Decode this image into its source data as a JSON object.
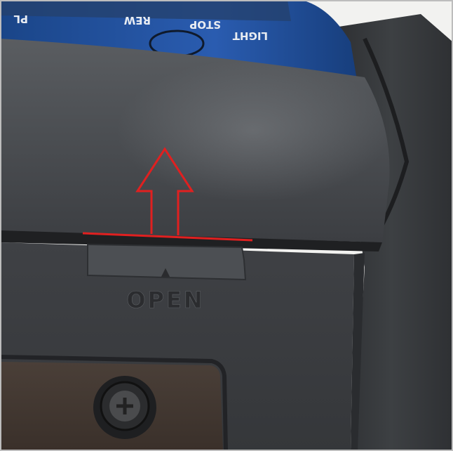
{
  "device": {
    "panel_labels": {
      "light": "LIGHT",
      "stop": "STOP",
      "rew": "REW",
      "play_partial": "PL"
    },
    "latch_label": "OPEN",
    "latch_symbol": "▲"
  },
  "annotation": {
    "arrow_color": "#e02020",
    "direction": "up"
  },
  "colors": {
    "body_dark": "#3a3c3f",
    "body_light": "#55585c",
    "blue_panel": "#1f4f9a",
    "background": "#f2f2f0"
  }
}
